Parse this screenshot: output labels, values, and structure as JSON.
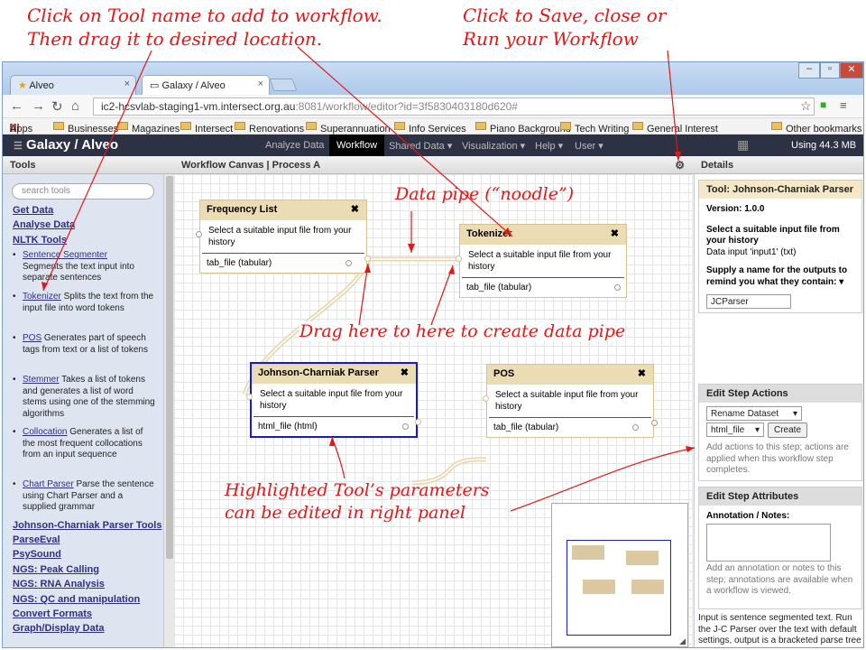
{
  "annotations": {
    "top_left_1": "Click on Tool name to add to workflow.",
    "top_left_2": "Then drag it to desired location.",
    "top_right_1": "Click to Save, close or",
    "top_right_2": "Run your Workflow",
    "noodle": "Data pipe (“noodle”)",
    "drag": "Drag here to here to create data pipe",
    "hl_1": "Highlighted Tool’s parameters",
    "hl_2": "can be edited in right panel"
  },
  "browser": {
    "tabs": [
      {
        "label": "Alveo"
      },
      {
        "label": "Galaxy / Alveo"
      }
    ],
    "url_host": "ic2-hcsvlab-staging1-vm.intersect.org.au",
    "url_rest": ":8081/workflow/editor?id=3f5830403180d620#",
    "bookmarks": [
      "Apps",
      "Businesses",
      "Magazines",
      "Intersect",
      "Renovations",
      "Superannuation",
      "Info Services",
      "Piano Background",
      "Tech Writing",
      "General Interest",
      "Other bookmarks"
    ]
  },
  "galaxy": {
    "brand": "Galaxy / Alveo",
    "menu": [
      "Analyze Data",
      "Workflow",
      "Shared Data ▾",
      "Visualization ▾",
      "Help ▾",
      "User ▾"
    ],
    "usage": "Using 44.3 MB"
  },
  "tools_panel": {
    "title": "Tools",
    "search_placeholder": "search tools",
    "sections": [
      "Get Data",
      "Analyse Data",
      "NLTK Tools"
    ],
    "items": [
      {
        "name": "Sentence Segmenter",
        "desc": "Segments the text input into separate sentences"
      },
      {
        "name": "Tokenizer",
        "desc": "Splits the text from the input file into word tokens"
      },
      {
        "name": "POS",
        "desc": "Generates part of speech tags from text or a list of tokens"
      },
      {
        "name": "Stemmer",
        "desc": "Takes a list of tokens and generates a list of word stems using one of the stemming algorithms"
      },
      {
        "name": "Collocation",
        "desc": "Generates a list of the most frequent collocations from an input sequence"
      },
      {
        "name": "Chart Parser",
        "desc": "Parse the sentence using Chart Parser and a supplied grammar"
      }
    ],
    "more_sections": [
      "Johnson-Charniak Parser Tools",
      "ParseEval",
      "PsySound",
      "NGS: Peak Calling",
      "NGS: RNA Analysis",
      "NGS: QC and manipulation",
      "Convert Formats",
      "Graph/Display Data"
    ]
  },
  "canvas": {
    "title": "Workflow Canvas | Process A",
    "nodes": [
      {
        "title": "Frequency List",
        "body": "Select a suitable input file from your history",
        "output": "tab_file (tabular)"
      },
      {
        "title": "Tokenizer",
        "body": "Select a suitable input file from your history",
        "output": "tab_file (tabular)"
      },
      {
        "title": "Johnson-Charniak Parser",
        "body": "Select a suitable input file from your history",
        "output": "html_file (html)"
      },
      {
        "title": "POS",
        "body": "Select a suitable input file from your history",
        "output": "tab_file (tabular)"
      }
    ]
  },
  "details": {
    "title": "Details",
    "tool_header": "Tool: Johnson-Charniak Parser",
    "version": "Version: 1.0.0",
    "input_label": "Select a suitable input file from your history",
    "input_value": "Data input 'input1' (txt)",
    "outputs_label": "Supply a name for the outputs to remind you what they contain:",
    "outputs_value": "JCParser",
    "actions_header": "Edit Step Actions",
    "action_select": "Rename Dataset",
    "output_select": "html_file",
    "create_label": "Create",
    "actions_hint": "Add actions to this step; actions are applied when this workflow step completes.",
    "attrs_header": "Edit Step Attributes",
    "notes_label": "Annotation / Notes:",
    "notes_hint": "Add an annotation or notes to this step; annotations are available when a workflow is viewed.",
    "notes_text": "Input is sentence segmented text. Run the J-C Parser over the text with default settings, output is a bracketed parse tree for the sentences."
  }
}
